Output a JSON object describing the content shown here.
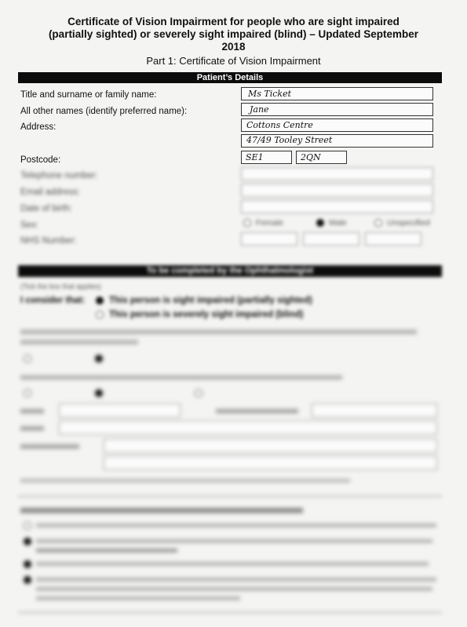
{
  "header": {
    "title": "Certificate of Vision Impairment for people who are sight impaired (partially sighted) or severely sight impaired (blind) – Updated September 2018",
    "part": "Part 1: Certificate of Vision Impairment"
  },
  "patient": {
    "section_title": "Patient’s Details",
    "title_label": "Title and surname or family name:",
    "title_value": "Ms Ticket",
    "names_label": "All other names (identify preferred name):",
    "names_value": "Jane",
    "address_label": "Address:",
    "address_line1": "Cottons Centre",
    "address_line2": "47/49 Tooley Street",
    "postcode_label": "Postcode:",
    "postcode_part1": "SE1",
    "postcode_part2": "2QN",
    "telephone_label": "Telephone number:",
    "telephone_value": "",
    "email_label": "Email address:",
    "email_value": "",
    "dob_label": "Date of birth:",
    "dob_value": "",
    "sex_label": "Sex:",
    "sex_options": [
      "Female",
      "Male",
      "Unspecified"
    ],
    "sex_selected": "Male",
    "nhs_label": "NHS Number:"
  },
  "ophthalmologist": {
    "section_title": "To be completed by the Ophthalmologist",
    "tick_note": "(Tick the box that applies)",
    "consider_label": "I consider that:",
    "option1": "This person is sight impaired (partially sighted)",
    "option2": "This person is severely sight impaired (blind)",
    "option1_selected": true
  }
}
